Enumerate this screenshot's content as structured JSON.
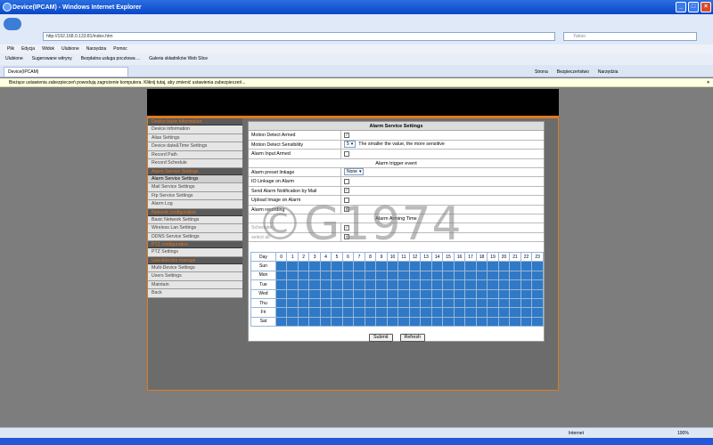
{
  "window": {
    "title": "Device(IPCAM) - Windows Internet Explorer",
    "address": "http://192.168.0.133:81/index.htm",
    "search_placeholder": "Yahoo"
  },
  "menu": [
    "Plik",
    "Edycja",
    "Widok",
    "Ulubione",
    "Narzędzia",
    "Pomoc"
  ],
  "favorites": [
    "Ulubione",
    "Sugerowane witryny",
    "Bezpłatna usługa pocztowa ...",
    "Galeria składników Web Slice"
  ],
  "tab": {
    "label": "Device(IPCAM)"
  },
  "tools": [
    "Strona",
    "Bezpieczeństwo",
    "Narzędzia"
  ],
  "infobar": "Bieżące ustawienia zabezpieczeń powodują zagrożenie komputera. Kliknij tutaj, aby zmienić ustawienia zabezpieczeń...",
  "sidebar": {
    "groups": [
      {
        "title": "Device basic information",
        "items": [
          "Device information",
          "Alias Settings",
          "Device date&Time Settings",
          "Record Path",
          "Record Schedule"
        ]
      },
      {
        "title": "Alarm Service Settings",
        "items": [
          "Alarm Service Settings",
          "Mail Service Settings",
          "Ftp Service Settings",
          "Alarm Log"
        ]
      },
      {
        "title": "Network configuration",
        "items": [
          "Basic Network Settings",
          "Wireless Lan Settings",
          "DDNS Service Settings"
        ]
      },
      {
        "title": "PTZ configuration",
        "items": [
          "PTZ Settings"
        ]
      },
      {
        "title": "User&device manage",
        "items": [
          "Multi-Device Settings",
          "Users Settings",
          "Maintain",
          "Back"
        ]
      }
    ],
    "active": "Alarm Service Settings"
  },
  "form": {
    "title": "Alarm Service Settings",
    "motion_detect_armed": {
      "label": "Motion Detect Armed",
      "checked": true
    },
    "sensitivity": {
      "label": "Motion Detect Sensibility",
      "value": "5",
      "hint": "The smaller the value, the more sensitive"
    },
    "alarm_input_armed": {
      "label": "Alarm Input Armed",
      "checked": false
    },
    "trigger_title": "Alarm trigger event",
    "preset": {
      "label": "Alarm preset linkage",
      "value": "None"
    },
    "io_linkage": {
      "label": "IO Linkage on Alarm",
      "checked": false
    },
    "mail": {
      "label": "Send Alarm Notification by Mail",
      "checked": true
    },
    "upload": {
      "label": "Upload Image on Alarm",
      "checked": false
    },
    "recording": {
      "label": "Alarm recording",
      "checked": true
    },
    "arming_title": "Alarm Arming Time",
    "scheduler": {
      "label": "Scheduler",
      "checked": true
    },
    "select_all": {
      "label": "select all",
      "checked": true
    },
    "day_header": "Day",
    "hours": [
      "0",
      "1",
      "2",
      "3",
      "4",
      "5",
      "6",
      "7",
      "8",
      "9",
      "10",
      "11",
      "12",
      "13",
      "14",
      "15",
      "16",
      "17",
      "18",
      "19",
      "20",
      "21",
      "22",
      "23"
    ],
    "days": [
      "Sun",
      "Mon",
      "Tue",
      "Wed",
      "Thu",
      "Fri",
      "Sat"
    ],
    "submit": "Submit",
    "refresh": "Refresh"
  },
  "watermark": "G1974",
  "status": {
    "zone": "Internet",
    "zoom": "100%"
  }
}
